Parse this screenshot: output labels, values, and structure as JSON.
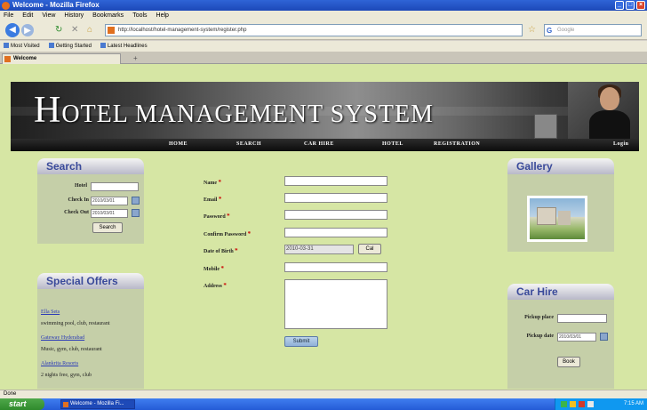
{
  "browser": {
    "window_title": "Welcome - Mozilla Firefox",
    "menu": [
      "File",
      "Edit",
      "View",
      "History",
      "Bookmarks",
      "Tools",
      "Help"
    ],
    "url": "http://localhost/hotel-management-system/register.php",
    "search_placeholder": "Google",
    "bookmarks": [
      "Most Visited",
      "Getting Started",
      "Latest Headlines"
    ],
    "tab_title": "Welcome",
    "status": "Done"
  },
  "site": {
    "title_first_letter_1": "H",
    "title_word_1": "OTEL",
    "title_first_letter_2": "M",
    "title_word_2": "ANAGEMENT",
    "title_first_letter_3": "S",
    "title_word_3": "YSTEM",
    "nav": [
      "HOME",
      "SEARCH",
      "CAR HIRE",
      "HOTEL",
      "REGISTRATION"
    ],
    "login": "Login"
  },
  "search_box": {
    "heading": "Search",
    "hotel_label": "Hotel",
    "checkin_label": "Check In",
    "checkin_value": "2010/03/01",
    "checkout_label": "Check Out",
    "checkout_value": "2010/03/01",
    "button": "Search"
  },
  "special_offers": {
    "heading": "Special Offers",
    "items": [
      {
        "name": "Ella Sets",
        "desc": "swimming pool, club, restaurant"
      },
      {
        "name": "Gateway Hyderabad",
        "desc": "Music, gym, club, restaurant"
      },
      {
        "name": "Alankrita Resorts",
        "desc": "2 nights free, gym, club"
      }
    ]
  },
  "registration": {
    "name_label": "Name",
    "email_label": "Email",
    "password_label": "Password",
    "confirm_label": "Confirm Password",
    "dob_label": "Date of Birth",
    "dob_value": "2010-03-31",
    "cal_button": "Cal",
    "mobile_label": "Mobile",
    "address_label": "Address",
    "submit": "Submit",
    "required_mark": "*"
  },
  "gallery": {
    "heading": "Gallery"
  },
  "car_hire": {
    "heading": "Car Hire",
    "pickup_place_label": "Pickup place",
    "pickup_date_label": "Pickup date",
    "pickup_date_value": "2010/03/01",
    "button": "Book"
  },
  "taskbar": {
    "start": "start",
    "task": "Welcome - Mozilla Fi...",
    "clock": "7:15 AM"
  }
}
